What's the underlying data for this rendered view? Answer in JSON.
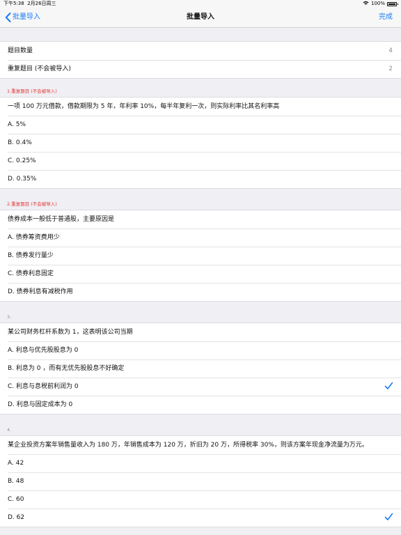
{
  "status": {
    "time": "下午5:38",
    "date": "2月26日周三",
    "battery": "100%"
  },
  "nav": {
    "back_label": "批量导入",
    "title": "批量导入",
    "done_label": "完成"
  },
  "summary": [
    {
      "label": "题目数量",
      "value": "4"
    },
    {
      "label": "重复题目 (不会被导入)",
      "value": "2"
    }
  ],
  "questions": [
    {
      "header": "1.重复题目 (不会被导入)",
      "stem": "一项 100 万元借款，借款期限为 5 年，年利率 10%，每半年复利一次，则实际利率比其名利率高",
      "options": [
        "A. 5%",
        "B. 0.4%",
        "C. 0.25%",
        "D. 0.35%"
      ]
    },
    {
      "header": "2.重复题目 (不会被导入)",
      "stem": "债券成本一般低于普通股，主要原因是",
      "options": [
        "A. 债券筹资费用少",
        "B. 债券发行量少",
        "C. 债券利息固定",
        "D. 债券利息有减税作用"
      ]
    },
    {
      "header": "3.",
      "stem": "某公司财务杠杆系数为 1，这表明该公司当期",
      "options": [
        "A. 利息与优先股股息为 0",
        "B. 利息为 0 ，而有无优先股股息不好确定",
        "C. 利息与息税前利润为 0",
        "D. 利息与固定成本为 0"
      ]
    },
    {
      "header": "4.",
      "stem": "某企业投资方案年销售量收入为 180 万，年销售成本为 120 万，折旧为 20 万，所得税率 30%，则该方案年现金净流量为万元。",
      "options": [
        "A. 42",
        "B. 48",
        "C. 60",
        "D. 62"
      ]
    }
  ],
  "colors": {
    "accent": "#1a7cf5",
    "duplicate_header": "#e53935",
    "background": "#efeff4"
  }
}
